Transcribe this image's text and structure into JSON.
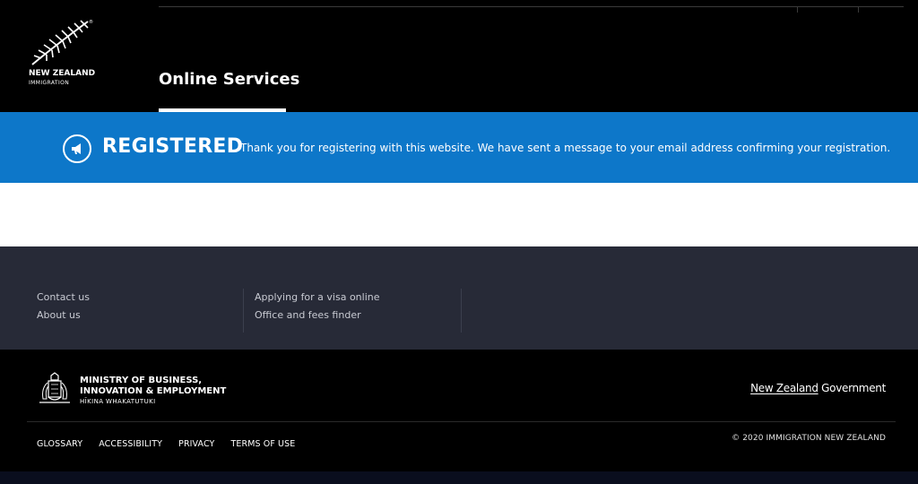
{
  "header": {
    "logo": {
      "line1": "NEW ZEALAND",
      "line2": "IMMIGRATION",
      "registered_mark": "®",
      "icon": "silver-fern-icon"
    },
    "nav_tab": "Online Services"
  },
  "banner": {
    "icon": "megaphone-icon",
    "title": "REGISTERED",
    "message": "Thank you for registering with this website. We have sent a message to your email address confirming your registration.",
    "color": "#0d77c9"
  },
  "footer_links": {
    "column1": [
      "Contact us",
      "About us"
    ],
    "column2": [
      "Applying for a visa online",
      "Office and fees finder"
    ]
  },
  "footer": {
    "mbie": {
      "line1": "MINISTRY OF BUSINESS,",
      "line2": "INNOVATION & EMPLOYMENT",
      "line3": "HĪKINA WHAKATUTUKI",
      "icon": "coat-of-arms-icon"
    },
    "nzgov_part1": "New Zealand",
    "nzgov_part2": " Government",
    "legal_links": [
      "GLOSSARY",
      "ACCESSIBILITY",
      "PRIVACY",
      "TERMS OF USE"
    ],
    "copyright": "© 2020 IMMIGRATION NEW ZEALAND"
  }
}
